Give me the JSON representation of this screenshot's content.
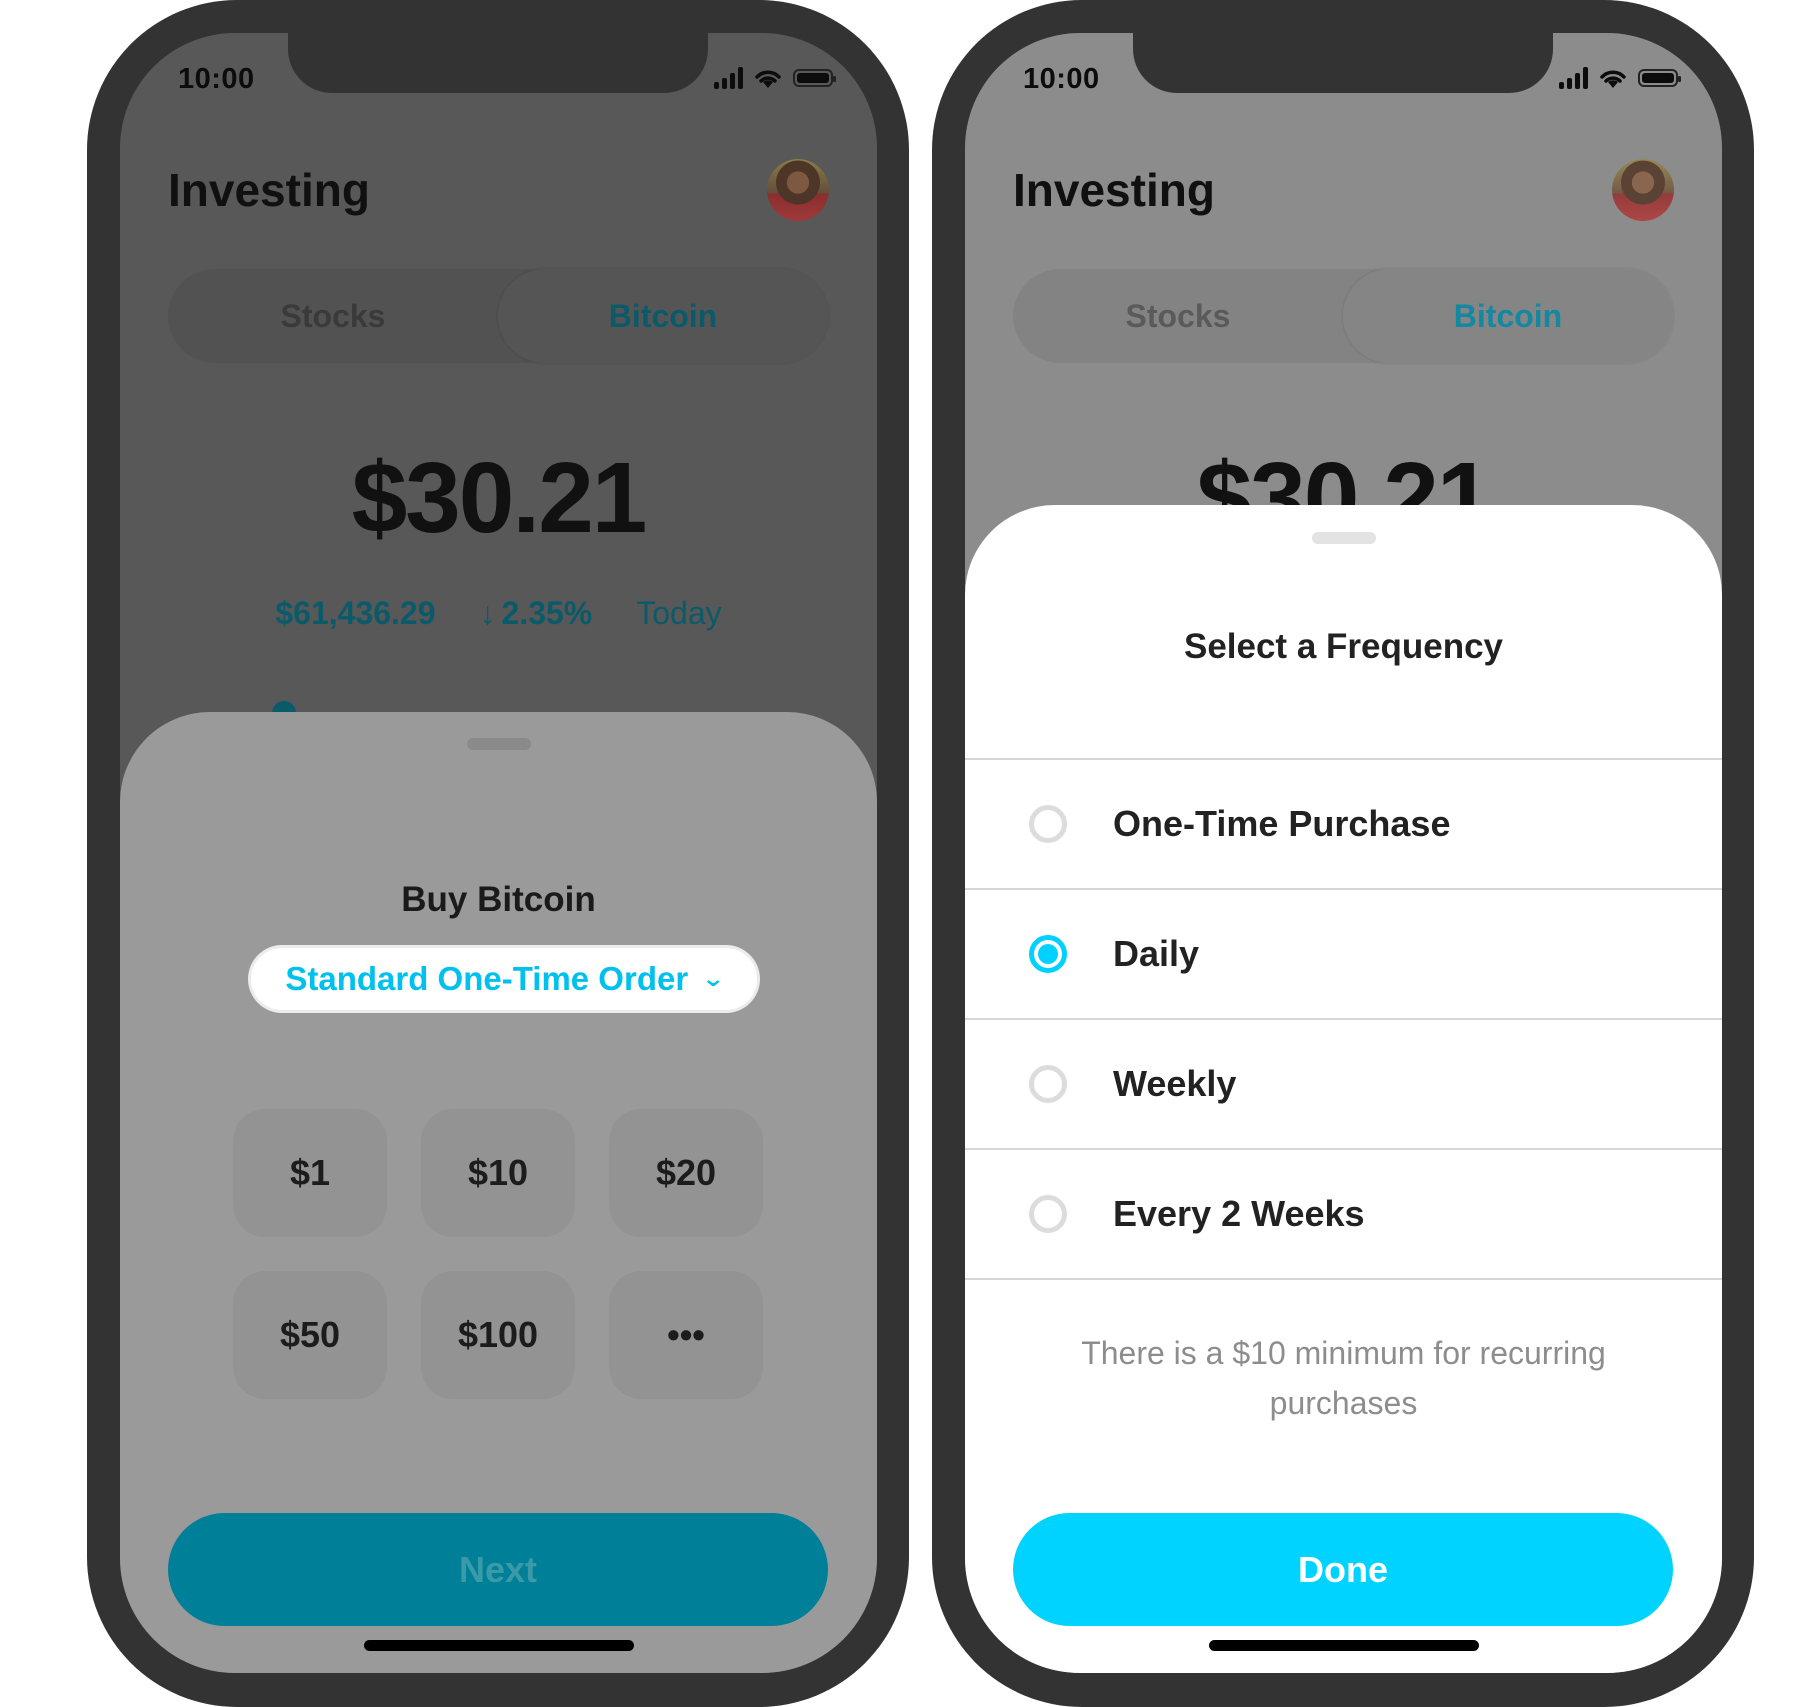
{
  "status_bar": {
    "time": "10:00"
  },
  "header": {
    "title": "Investing",
    "avatar": "user-avatar"
  },
  "segmented_control": {
    "tabs": [
      {
        "label": "Stocks",
        "active": false
      },
      {
        "label": "Bitcoin",
        "active": true
      }
    ]
  },
  "portfolio": {
    "balance": "$30.21",
    "btc_price": "$61,436.29",
    "change_arrow": "↓",
    "change_percent": "2.35%",
    "period": "Today"
  },
  "buy_sheet": {
    "title": "Buy Bitcoin",
    "order_type": "Standard One-Time Order",
    "order_type_chevron": "⌄",
    "amounts": [
      "$1",
      "$10",
      "$20",
      "$50",
      "$100",
      "•••"
    ],
    "next_label": "Next"
  },
  "frequency_sheet": {
    "title": "Select a Frequency",
    "options": [
      {
        "label": "One-Time Purchase",
        "selected": false
      },
      {
        "label": "Daily",
        "selected": true
      },
      {
        "label": "Weekly",
        "selected": false
      },
      {
        "label": "Every 2 Weeks",
        "selected": false
      }
    ],
    "note": "There is a $10 minimum for recurring purchases",
    "done_label": "Done"
  },
  "colors": {
    "accent": "#00d3ff",
    "accent_dimmed": "#007f99",
    "text_dark": "#222222",
    "phone_frame": "#333333"
  }
}
